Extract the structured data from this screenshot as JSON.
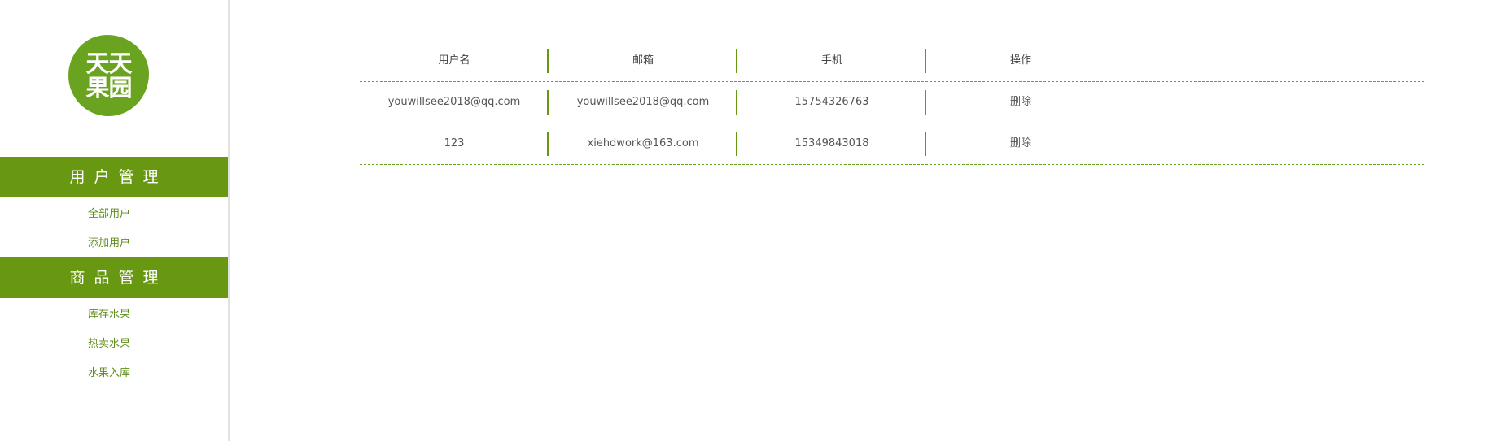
{
  "logo": {
    "line1": "天天",
    "line2": "果园"
  },
  "sidebar": {
    "sections": [
      {
        "title": "用户管理",
        "items": [
          "全部用户",
          "添加用户"
        ]
      },
      {
        "title": "商品管理",
        "items": [
          "库存水果",
          "热卖水果",
          "水果入库"
        ]
      }
    ]
  },
  "table": {
    "headers": [
      "用户名",
      "邮箱",
      "手机",
      "操作"
    ],
    "rows": [
      {
        "username": "youwillsee2018@qq.com",
        "email": "youwillsee2018@qq.com",
        "phone": "15754326763",
        "action": "删除"
      },
      {
        "username": "123",
        "email": "xiehdwork@163.com",
        "phone": "15349843018",
        "action": "删除"
      }
    ]
  },
  "colors": {
    "brand_green": "#689812",
    "link_green": "#5f8e1c",
    "logo_green": "#6aa31f"
  }
}
